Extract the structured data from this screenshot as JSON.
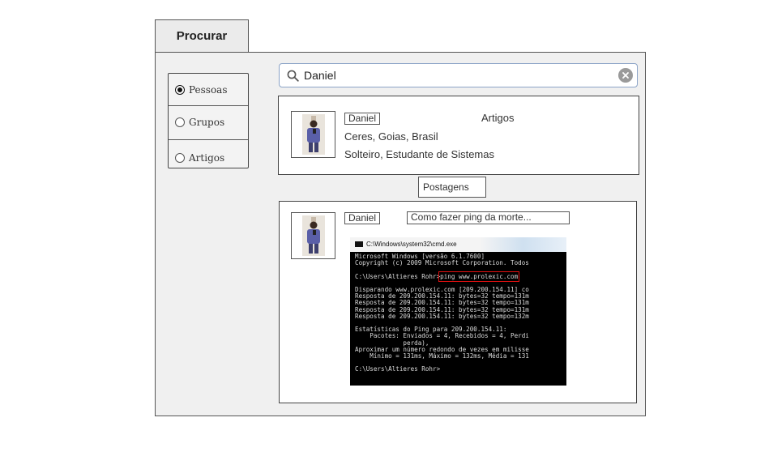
{
  "tab": {
    "label": "Procurar"
  },
  "filters": [
    {
      "label": "Pessoas",
      "selected": true
    },
    {
      "label": "Grupos",
      "selected": false
    },
    {
      "label": "Artigos",
      "selected": false
    }
  ],
  "search": {
    "value": "Daniel",
    "icon": "search-icon",
    "clear_icon": "clear-icon"
  },
  "profile": {
    "name": "Daniel",
    "articles_label": "Artigos",
    "location": "Ceres, Goias, Brasil",
    "description": "Solteiro, Estudante de Sistemas"
  },
  "posts_button": {
    "label": "Postagens"
  },
  "post": {
    "author": "Daniel",
    "title": "Como fazer ping da morte...",
    "terminal": {
      "title": "C:\\Windows\\system32\\cmd.exe",
      "lines": [
        "Microsoft Windows [versão 6.1.7600]",
        "Copyright (c) 2009 Microsoft Corporation. Todos",
        "",
        "C:\\Users\\Altieres Rohr>",
        "",
        "Disparando www.prolexic.com [209.200.154.11] co",
        "Resposta de 209.200.154.11: bytes=32 tempo=131m",
        "Resposta de 209.200.154.11: bytes=32 tempo=131m",
        "Resposta de 209.200.154.11: bytes=32 tempo=131m",
        "Resposta de 209.200.154.11: bytes=32 tempo=132m",
        "",
        "Estatísticas do Ping para 209.200.154.11:",
        "    Pacotes: Enviados = 4, Recebidos = 4, Perdi",
        "             perda),",
        "Aproximar um número redondo de vezes em milisse",
        "    Mínimo = 131ms, Máximo = 132ms, Média = 131",
        "",
        "C:\\Users\\Altieres Rohr>"
      ],
      "highlighted_command": "ping www.prolexic.com"
    }
  }
}
